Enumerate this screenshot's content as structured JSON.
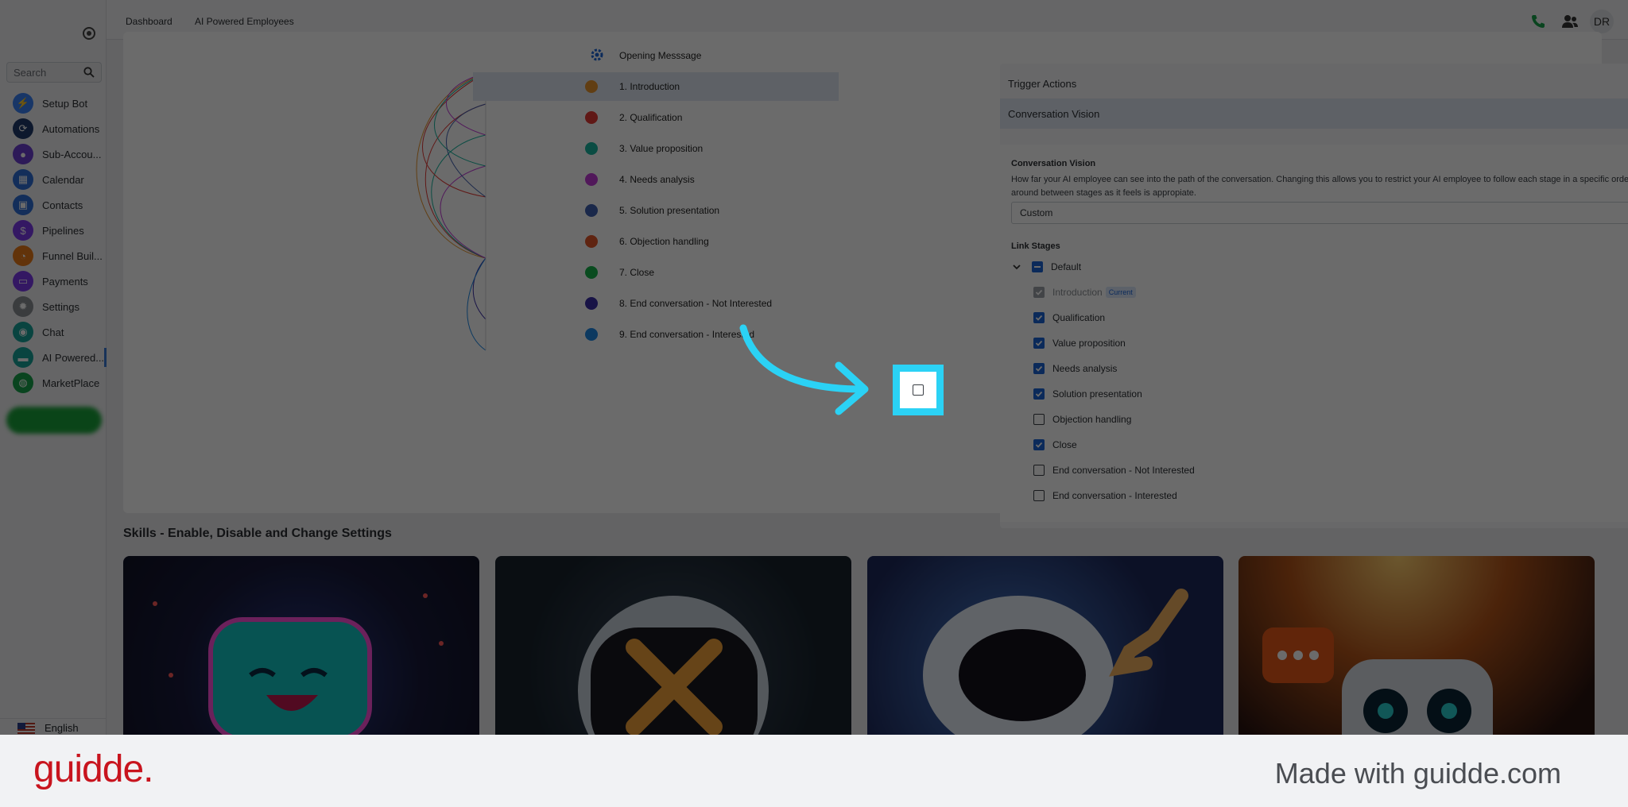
{
  "sidebar": {
    "search_placeholder": "Search",
    "items": [
      {
        "label": "Setup Bot",
        "color": "#3b82f6",
        "glyph": "⚡"
      },
      {
        "label": "Automations",
        "color": "#1f3a6b",
        "glyph": "⟳"
      },
      {
        "label": "Sub-Accou...",
        "color": "#6d3fd1",
        "glyph": "●"
      },
      {
        "label": "Calendar",
        "color": "#2f6fd6",
        "glyph": "▦"
      },
      {
        "label": "Contacts",
        "color": "#2f6fd6",
        "glyph": "▣"
      },
      {
        "label": "Pipelines",
        "color": "#7c3aed",
        "glyph": "$"
      },
      {
        "label": "Funnel Buil...",
        "color": "#ea7a1a",
        "glyph": "◔"
      },
      {
        "label": "Payments",
        "color": "#7c3aed",
        "glyph": "▭"
      },
      {
        "label": "Settings",
        "color": "#8a8f95",
        "glyph": "✹"
      },
      {
        "label": "Chat",
        "color": "#16a39a",
        "glyph": "◉"
      },
      {
        "label": "AI Powered...",
        "color": "#16a39a",
        "glyph": "▬"
      },
      {
        "label": "MarketPlace",
        "color": "#16a34a",
        "glyph": "◍"
      }
    ],
    "language": "English"
  },
  "topbar": {
    "tabs": [
      "Dashboard",
      "AI Powered Employees"
    ],
    "avatar": "DR"
  },
  "stages": {
    "opening": "Opening Messsage",
    "items": [
      {
        "label": "1. Introduction",
        "color": "#e8952e"
      },
      {
        "label": "2. Qualification",
        "color": "#e53935"
      },
      {
        "label": "3. Value proposition",
        "color": "#19b6a0"
      },
      {
        "label": "4. Needs analysis",
        "color": "#c03ad6"
      },
      {
        "label": "5. Solution presentation",
        "color": "#3f5fb0"
      },
      {
        "label": "6. Objection handling",
        "color": "#e2572a"
      },
      {
        "label": "7. Close",
        "color": "#17b34a"
      },
      {
        "label": "8. End conversation - Not Interested",
        "color": "#3b2fa8"
      },
      {
        "label": "9. End conversation - Interested",
        "color": "#1e88e5"
      }
    ]
  },
  "accordion": {
    "trigger_actions": "Trigger Actions",
    "conversation_vision": "Conversation Vision",
    "section_title": "Conversation Vision",
    "description": "How far your AI employee can see into the path of the conversation. Changing this allows you to restrict your AI employee to follow each stage in a specific order or bounce around between stages as it feels is appropiate.",
    "vision_value": "Custom",
    "link_stages_title": "Link Stages",
    "default_label": "Default",
    "current_badge": "Current",
    "link_stages": [
      {
        "label": "Introduction",
        "state": "grey"
      },
      {
        "label": "Qualification",
        "state": "on"
      },
      {
        "label": "Value proposition",
        "state": "on"
      },
      {
        "label": "Needs analysis",
        "state": "on"
      },
      {
        "label": "Solution presentation",
        "state": "on"
      },
      {
        "label": "Objection handling",
        "state": "off"
      },
      {
        "label": "Close",
        "state": "on"
      },
      {
        "label": "End conversation - Not Interested",
        "state": "off"
      },
      {
        "label": "End conversation - Interested",
        "state": "off"
      }
    ]
  },
  "skills": {
    "title": "Skills - Enable, Disable and Change Settings"
  },
  "footer": {
    "brand": "guidde.",
    "made_with": "Made with guidde.com"
  }
}
